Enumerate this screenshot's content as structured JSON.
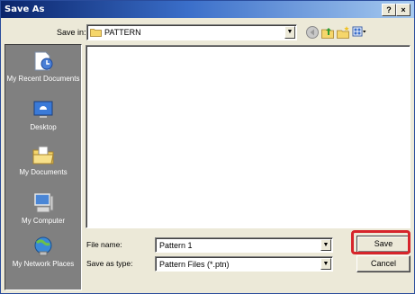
{
  "window": {
    "title": "Save As",
    "help_glyph": "?",
    "close_glyph": "×"
  },
  "toolbar": {
    "save_in_label": "Save in:",
    "save_in_value": "PATTERN",
    "icons": [
      "back-icon",
      "up-folder-icon",
      "new-folder-icon",
      "views-menu-icon"
    ]
  },
  "places": [
    {
      "label": "My Recent Documents",
      "icon": "recent-documents-icon"
    },
    {
      "label": "Desktop",
      "icon": "desktop-icon"
    },
    {
      "label": "My Documents",
      "icon": "my-documents-icon"
    },
    {
      "label": "My Computer",
      "icon": "my-computer-icon"
    },
    {
      "label": "My Network Places",
      "icon": "network-places-icon"
    }
  ],
  "form": {
    "file_name_label": "File name:",
    "file_name_value": "Pattern 1",
    "save_as_type_label": "Save as type:",
    "save_as_type_value": "Pattern Files (*.ptn)"
  },
  "buttons": {
    "save": "Save",
    "cancel": "Cancel"
  },
  "colors": {
    "highlight": "#d6252b",
    "titlebar": "#0a246a"
  }
}
